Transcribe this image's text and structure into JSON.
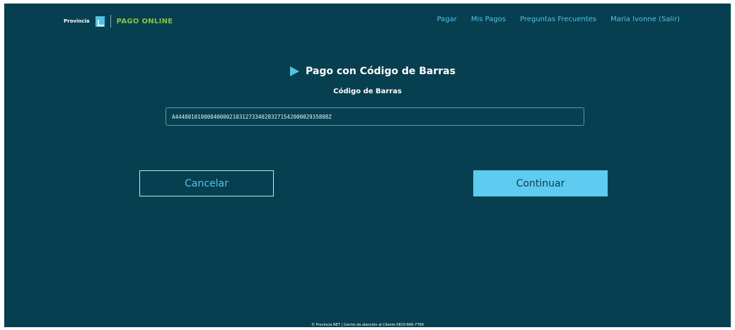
{
  "header": {
    "logo_brand": "Provincia",
    "logo_text": "PAGO ONLINE",
    "nav": [
      "Pagar",
      "Mis Pagos",
      "Preguntas Frecuentes",
      "Maria Ivonne (Salir)"
    ]
  },
  "main": {
    "title": "Pago con Código de Barras",
    "field_label": "Código de Barras",
    "barcode_value": "A444801010000400002103127334028327154200002935808Z",
    "cancel_label": "Cancelar",
    "continue_label": "Continuar"
  },
  "footer": {
    "text": "© Provincia NET | Centro de atención al Cliente 0810-666-7768"
  },
  "colors": {
    "background": "#063f4f",
    "accent": "#4fc3e8",
    "logo_green": "#8bc53f",
    "button_primary": "#5ecbf0"
  }
}
